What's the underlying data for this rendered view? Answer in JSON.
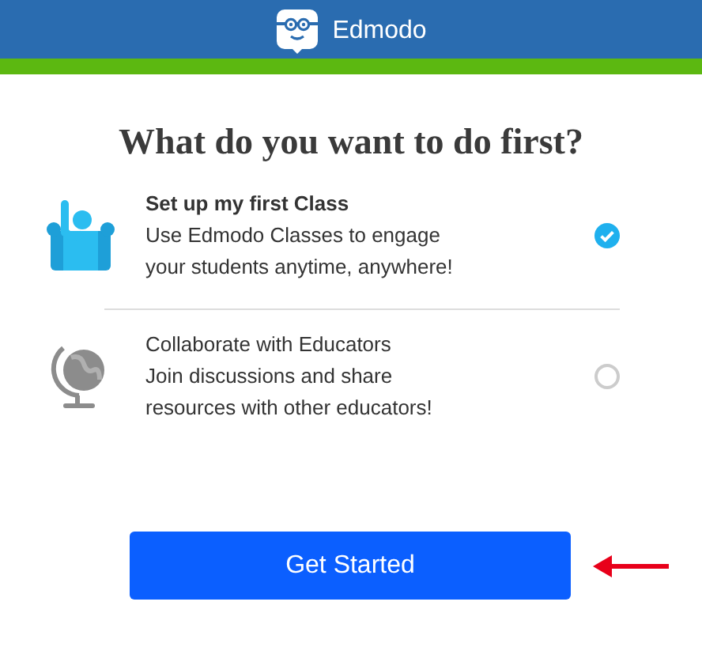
{
  "header": {
    "title": "Edmodo"
  },
  "heading": "What do you want to do first?",
  "options": [
    {
      "kind": "class",
      "title": "Set up my first Class",
      "description": "Use Edmodo Classes to engage your students anytime, anywhere!",
      "selected": true
    },
    {
      "kind": "globe",
      "title": "Collaborate with Educators",
      "description": "Join discussions and share resources with other educators!",
      "selected": false
    }
  ],
  "button": {
    "label": "Get Started"
  }
}
